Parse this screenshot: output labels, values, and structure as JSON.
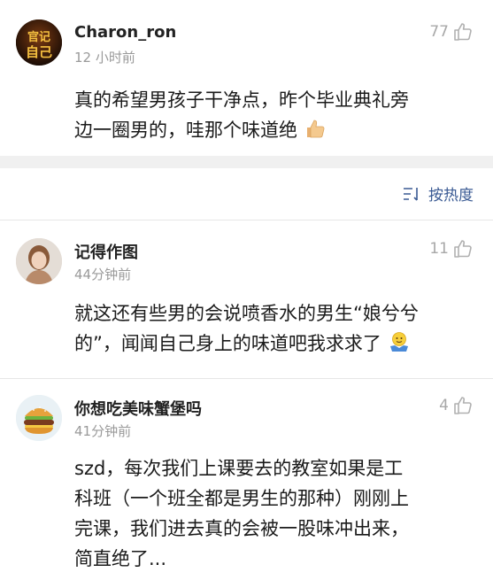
{
  "comments": [
    {
      "username": "Charon_ron",
      "time": "12 小时前",
      "likes": "77",
      "text_lines": [
        "真的希望男孩子干净点，昨个毕业典礼旁",
        "边一圈男的，哇那个味道绝"
      ],
      "avatar_text": "官记自己",
      "emoji": "thumbs-up-emoji"
    },
    {
      "username": "记得作图",
      "time": "44分钟前",
      "likes": "11",
      "text_lines": [
        "就这还有些男的会说喷香水的男生“娘兮兮",
        "的”，闻闻自己身上的味道吧我求求了"
      ],
      "emoji": "shrug-emoji"
    },
    {
      "username": "你想吃美味蟹堡吗",
      "time": "41分钟前",
      "likes": "4",
      "text_lines": [
        "szd，每次我们上课要去的教室如果是工",
        "科班（一个班全都是男生的那种）刚刚上",
        "完课，我们进去真的会被一股味冲出来，",
        "简直绝了..."
      ]
    }
  ],
  "sort": {
    "label": "按热度",
    "icon": "sort-icon"
  },
  "colors": {
    "accent": "#3a5a93",
    "meta": "#9a9a9a"
  }
}
